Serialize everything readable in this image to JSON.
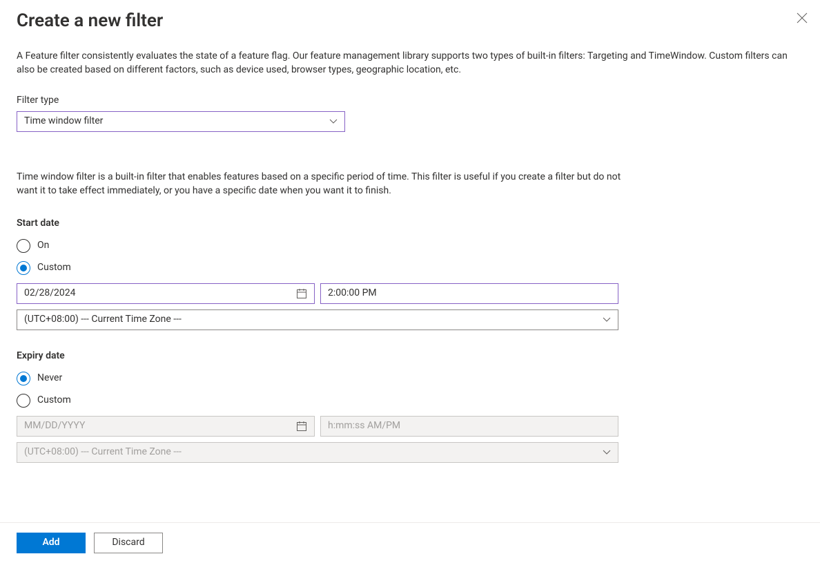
{
  "title": "Create a new filter",
  "description": "A Feature filter consistently evaluates the state of a feature flag. Our feature management library supports two types of built-in filters: Targeting and TimeWindow. Custom filters can also be created based on different factors, such as device used, browser types, geographic location, etc.",
  "filter_type": {
    "label": "Filter type",
    "value": "Time window filter"
  },
  "filter_help": "Time window filter is a built-in filter that enables features based on a specific period of time. This filter is useful if you create a filter but do not want it to take effect immediately, or you have a specific date when you want it to finish.",
  "start_date": {
    "title": "Start date",
    "options": {
      "on": "On",
      "custom": "Custom"
    },
    "selected": "custom",
    "date_value": "02/28/2024",
    "time_value": "2:00:00 PM",
    "timezone_value": "(UTC+08:00) --- Current Time Zone ---"
  },
  "expiry_date": {
    "title": "Expiry date",
    "options": {
      "never": "Never",
      "custom": "Custom"
    },
    "selected": "never",
    "date_placeholder": "MM/DD/YYYY",
    "time_placeholder": "h:mm:ss AM/PM",
    "timezone_value": "(UTC+08:00) --- Current Time Zone ---"
  },
  "footer": {
    "add": "Add",
    "discard": "Discard"
  }
}
